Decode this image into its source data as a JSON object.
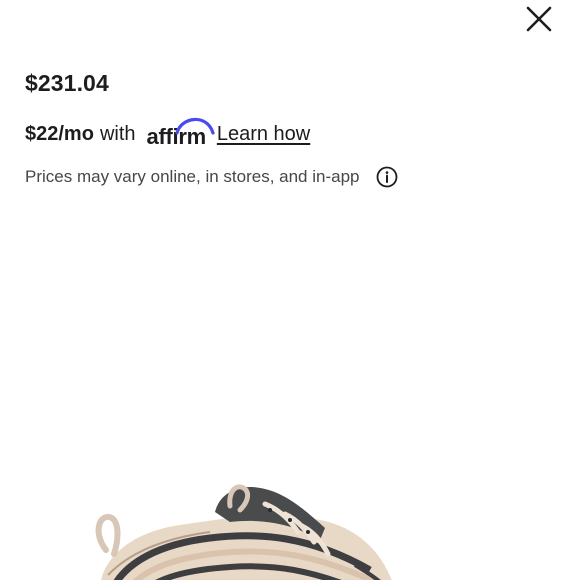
{
  "product": {
    "price": "$231.04"
  },
  "financing": {
    "monthly": "$22/mo",
    "with_label": "with",
    "provider_logo": "affirm",
    "learn_more": "Learn how"
  },
  "disclaimer": {
    "text": "Prices may vary online, in stores, and in-app"
  },
  "icons": {
    "close": "close-icon",
    "info": "info-icon"
  },
  "colors": {
    "text": "#1d1d1f",
    "affirm_arc": "#4a4af4"
  }
}
